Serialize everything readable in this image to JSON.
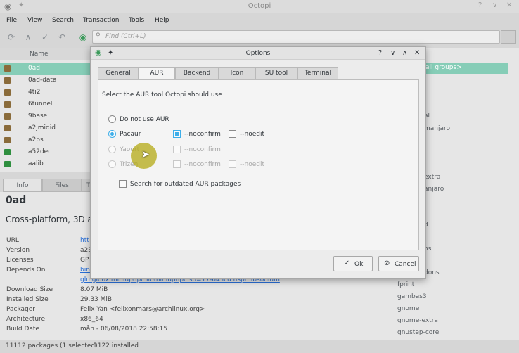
{
  "window": {
    "title": "Octopi"
  },
  "menu": [
    "File",
    "View",
    "Search",
    "Transaction",
    "Tools",
    "Help"
  ],
  "search": {
    "placeholder": "Find  (Ctrl+L)"
  },
  "package_list": {
    "column_name": "Name",
    "rows": [
      {
        "name": "0ad",
        "selected": true
      },
      {
        "name": "0ad-data"
      },
      {
        "name": "4ti2"
      },
      {
        "name": "6tunnel"
      },
      {
        "name": "9base"
      },
      {
        "name": "a2jmidid"
      },
      {
        "name": "a2ps"
      },
      {
        "name": "a52dec",
        "installed": true
      },
      {
        "name": "aalib",
        "installed": true
      }
    ]
  },
  "groups": {
    "selected": "all groups>",
    "items": [
      "al",
      "manjaro",
      "extra",
      "anjaro",
      "d",
      "ns",
      "dons",
      "fprint",
      "gambas3",
      "gnome",
      "gnome-extra",
      "gnustep-core"
    ]
  },
  "info_tabs": [
    "Info",
    "Files",
    "T"
  ],
  "info": {
    "title": "0ad",
    "description": "Cross-platform, 3D and",
    "fields": [
      {
        "label": "URL",
        "value": "htt",
        "link": true
      },
      {
        "label": "Version",
        "value": "a23"
      },
      {
        "label": "Licenses",
        "value": "GP"
      },
      {
        "label": "Depends On",
        "value": "bin",
        "link": true
      },
      {
        "label": "",
        "value": "glu  gloox  miniupnpc  libminiupnpc.so=17-64  icu  nspr  libsodium",
        "link": true
      },
      {
        "label": "Download Size",
        "value": "8.07 MiB"
      },
      {
        "label": "Installed Size",
        "value": "29.33 MiB"
      },
      {
        "label": "Packager",
        "value": "Felix Yan <felixonmars@archlinux.org>"
      },
      {
        "label": "Architecture",
        "value": "x86_64"
      },
      {
        "label": "Build Date",
        "value": "mån - 06/08/2018 22:58:15"
      }
    ]
  },
  "status": {
    "packages": "11112 packages (1 selected)",
    "installed": "1122 installed"
  },
  "dialog": {
    "title": "Options",
    "ctrl_help": "?",
    "ctrl_min": "∨",
    "ctrl_max": "∧",
    "ctrl_close": "✕",
    "tabs": [
      "General",
      "AUR",
      "Backend",
      "Icon",
      "SU tool",
      "Terminal"
    ],
    "active_tab": "AUR",
    "heading": "Select the AUR tool Octopi should use",
    "options": {
      "none": "Do not use AUR",
      "pacaur": "Pacaur",
      "yaourt": "Yaourt",
      "trizen": "Trizen",
      "noconfirm": "--noconfirm",
      "noedit": "--noedit",
      "outdated": "Search for outdated AUR packages"
    },
    "ok": "Ok",
    "cancel": "Cancel"
  },
  "colors": {
    "accent": "#3daee9",
    "selection": "#86cdb7"
  }
}
